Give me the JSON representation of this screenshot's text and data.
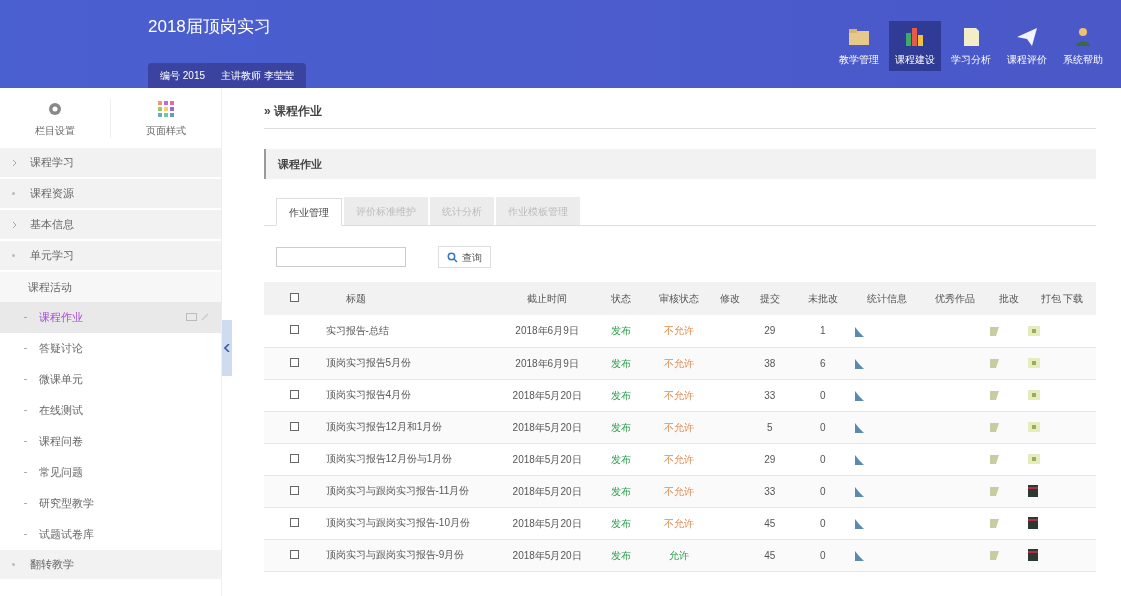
{
  "header": {
    "title": "2018届顶岗实习",
    "meta": [
      {
        "label": "编号",
        "value": "2015"
      },
      {
        "label": "主讲教师",
        "value": "李莹莹"
      }
    ],
    "nav": [
      {
        "label": "教学管理",
        "selected": false
      },
      {
        "label": "课程建设",
        "selected": true
      },
      {
        "label": "学习分析",
        "selected": false
      },
      {
        "label": "课程评价",
        "selected": false
      },
      {
        "label": "系统帮助",
        "selected": false
      }
    ]
  },
  "sidebar": {
    "tools": [
      "栏目设置",
      "页面样式"
    ],
    "items": [
      {
        "label": "课程学习",
        "expanded": false
      },
      {
        "label": "课程资源",
        "expanded": true
      },
      {
        "label": "基本信息",
        "expanded": false
      },
      {
        "label": "单元学习",
        "expanded": true
      },
      {
        "label": "课程活动",
        "children": [
          {
            "label": "课程作业",
            "selected": true
          },
          {
            "label": "答疑讨论",
            "selected": false
          },
          {
            "label": "微课单元",
            "selected": false
          },
          {
            "label": "在线测试",
            "selected": false
          },
          {
            "label": "课程问卷",
            "selected": false
          },
          {
            "label": "常见问题",
            "selected": false
          },
          {
            "label": "研究型教学",
            "selected": false
          },
          {
            "label": "试题试卷库",
            "selected": false
          }
        ]
      },
      {
        "label": "翻转教学",
        "expanded": true
      }
    ]
  },
  "breadcrumb": "» 课程作业",
  "panel_title": "课程作业",
  "tabs": [
    {
      "label": "作业管理",
      "selected": true
    },
    {
      "label": "评价标准维护",
      "selected": false
    },
    {
      "label": "统计分析",
      "selected": false
    },
    {
      "label": "作业模板管理",
      "selected": false
    }
  ],
  "search_button": "查询",
  "table": {
    "all_checked": false,
    "columns": [
      "标题",
      "截止时间",
      "状态",
      "审核状态",
      "修改",
      "提交",
      "未批改",
      "统计信息",
      "优秀作品",
      "批改",
      "打包 下载"
    ],
    "rows": [
      {
        "title": "实习报告-总结",
        "deadline": "2018年6月9日",
        "status": "发布",
        "review": "不允许",
        "allowed": false,
        "submitted": "29",
        "unmarked": "1",
        "archived": false,
        "checked": false
      },
      {
        "title": "顶岗实习报告5月份",
        "deadline": "2018年6月9日",
        "status": "发布",
        "review": "不允许",
        "allowed": false,
        "submitted": "38",
        "unmarked": "6",
        "archived": false,
        "checked": false
      },
      {
        "title": "顶岗实习报告4月份",
        "deadline": "2018年5月20日",
        "status": "发布",
        "review": "不允许",
        "allowed": false,
        "submitted": "33",
        "unmarked": "0",
        "archived": false,
        "checked": false
      },
      {
        "title": "顶岗实习报告12月和1月份",
        "deadline": "2018年5月20日",
        "status": "发布",
        "review": "不允许",
        "allowed": false,
        "submitted": "5",
        "unmarked": "0",
        "archived": false,
        "checked": false
      },
      {
        "title": "顶岗实习报告12月份与1月份",
        "deadline": "2018年5月20日",
        "status": "发布",
        "review": "不允许",
        "allowed": false,
        "submitted": "29",
        "unmarked": "0",
        "archived": false,
        "checked": false
      },
      {
        "title": "顶岗实习与跟岗实习报告-11月份",
        "deadline": "2018年5月20日",
        "status": "发布",
        "review": "不允许",
        "allowed": false,
        "submitted": "33",
        "unmarked": "0",
        "archived": true,
        "checked": false
      },
      {
        "title": "顶岗实习与跟岗实习报告-10月份",
        "deadline": "2018年5月20日",
        "status": "发布",
        "review": "不允许",
        "allowed": false,
        "submitted": "45",
        "unmarked": "0",
        "archived": true,
        "checked": false
      },
      {
        "title": "顶岗实习与跟岗实习报告-9月份",
        "deadline": "2018年5月20日",
        "status": "发布",
        "review": "允许",
        "allowed": true,
        "submitted": "45",
        "unmarked": "0",
        "archived": true,
        "checked": false
      }
    ]
  }
}
